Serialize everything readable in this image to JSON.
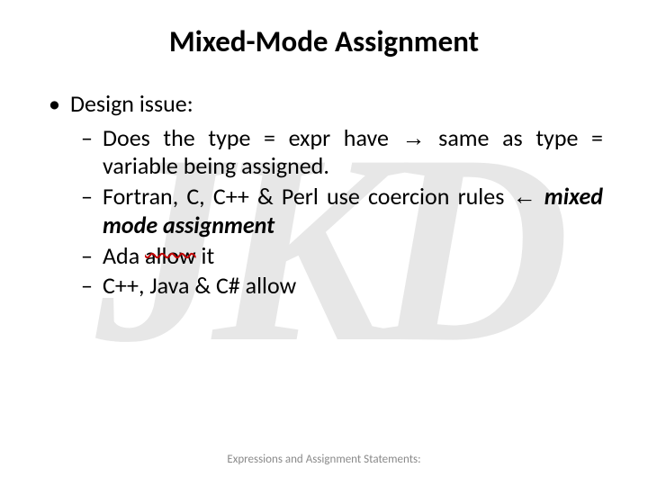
{
  "watermark": "JKD",
  "title": "Mixed-Mode Assignment",
  "bullet1": "Design issue:",
  "sub1_a": "Does the type = expr have ",
  "sub1_arrow": "→",
  "sub1_b": " same as type = variable being assigned.",
  "sub2_a": "Fortran, C, C++ & Perl use coercion rules ",
  "sub2_arrow": "←",
  "sub2_b": " ",
  "sub2_mixed": "mixed mode assignment",
  "sub3_a": "Ada ",
  "sub3_allow": "allow",
  "sub3_b": " it",
  "sub4": "C++, Java & C# allow",
  "footer": "Expressions and Assignment Statements:"
}
